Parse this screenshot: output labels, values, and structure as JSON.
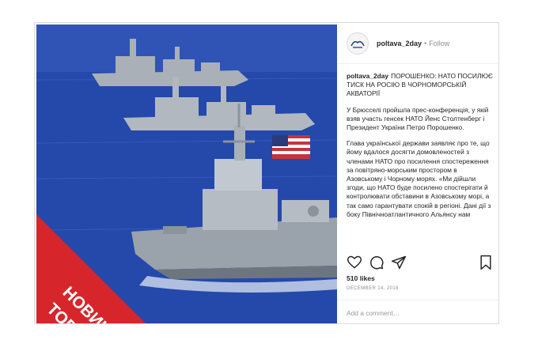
{
  "post": {
    "username": "poltava_2day",
    "follow_label": "Follow",
    "separator": "•",
    "caption_user": "poltava_2day",
    "caption_headline": "ПОРОШЕНКО: НАТО ПОСИЛЮЄ ТИСК НА РОСІЮ В ЧОРНОМОРСЬКІЙ АКВАТОРІЇ",
    "paragraph_1": "У Брюсселі пройшла прес-конференція, у якій взяв участь генсек НАТО Йенс Столтенберг і Президент України Петро Порошенко.",
    "paragraph_2": "Глава української держави заявляє про те, що йому вдалося досягти домовленостей з членами НАТО про посилення спостереження за повітряно-морським простором в Азовському і Чорному морях. «Ми дійшли згоди, що НАТО буде посилено спостерігати й контролювати обставини в Азовському морі, а так само гарантувати спокій в регіоні. Дані дії з боку Північноатлантичного Альянсу нам",
    "likes": "510 likes",
    "date": "DECEMBER 14, 2018",
    "comment_placeholder": "Add a comment…"
  },
  "image": {
    "badge_line_1": "НОВИНА",
    "badge_line_2": "TODAY",
    "badge_color": "#d6262b"
  },
  "icons": [
    "avatar-logo-icon",
    "heart-icon",
    "comment-icon",
    "share-icon",
    "bookmark-icon"
  ],
  "colors": {
    "sea": "#1f47ad",
    "ship_gray": "#9ea6ae",
    "text": "#262626",
    "muted": "#8e8e8e"
  }
}
